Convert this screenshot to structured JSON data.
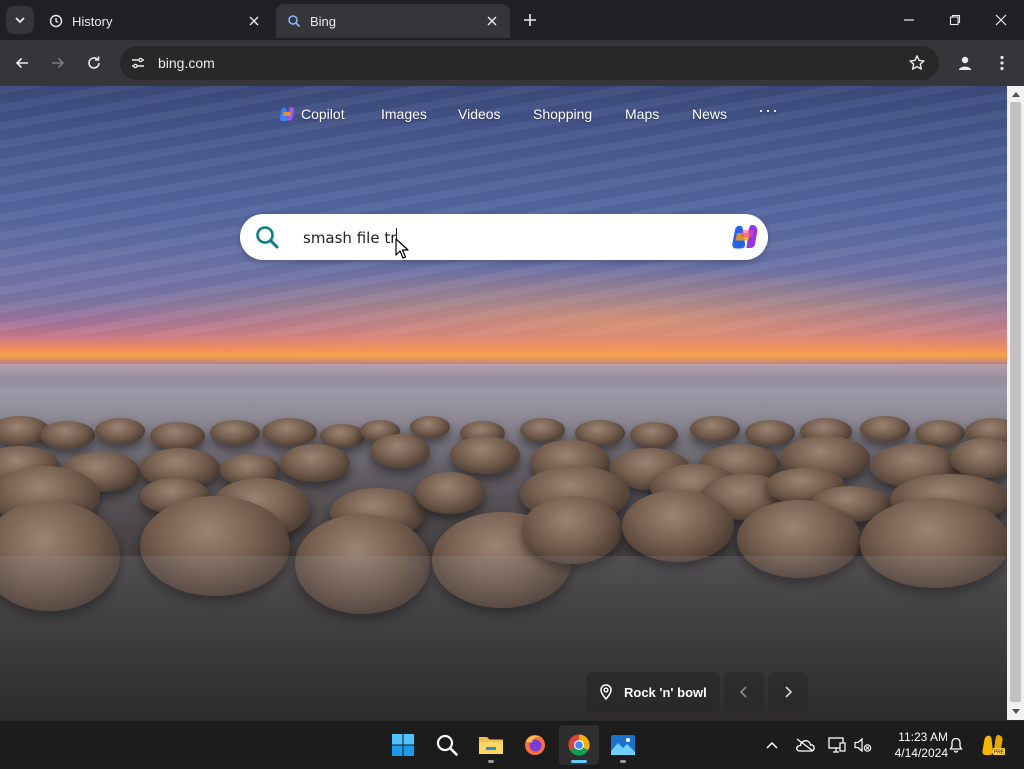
{
  "browser": {
    "tabs": [
      {
        "title": "History",
        "icon": "history-icon",
        "active": false
      },
      {
        "title": "Bing",
        "icon": "search-icon",
        "active": true
      }
    ],
    "url": "bing.com"
  },
  "bing": {
    "nav": [
      "Copilot",
      "Images",
      "Videos",
      "Shopping",
      "Maps",
      "News"
    ],
    "more_label": "···",
    "search_query": "smash file tr",
    "image_caption": "Rock 'n' bowl"
  },
  "taskbar": {
    "apps": [
      "start-icon",
      "search-icon",
      "file-explorer-icon",
      "firefox-icon",
      "chrome-icon",
      "photos-icon"
    ],
    "time": "11:23 AM",
    "date": "4/14/2024"
  },
  "colors": {
    "bing_accent": "#0e7a8a",
    "taskbar_indicator": "#60cdff"
  }
}
